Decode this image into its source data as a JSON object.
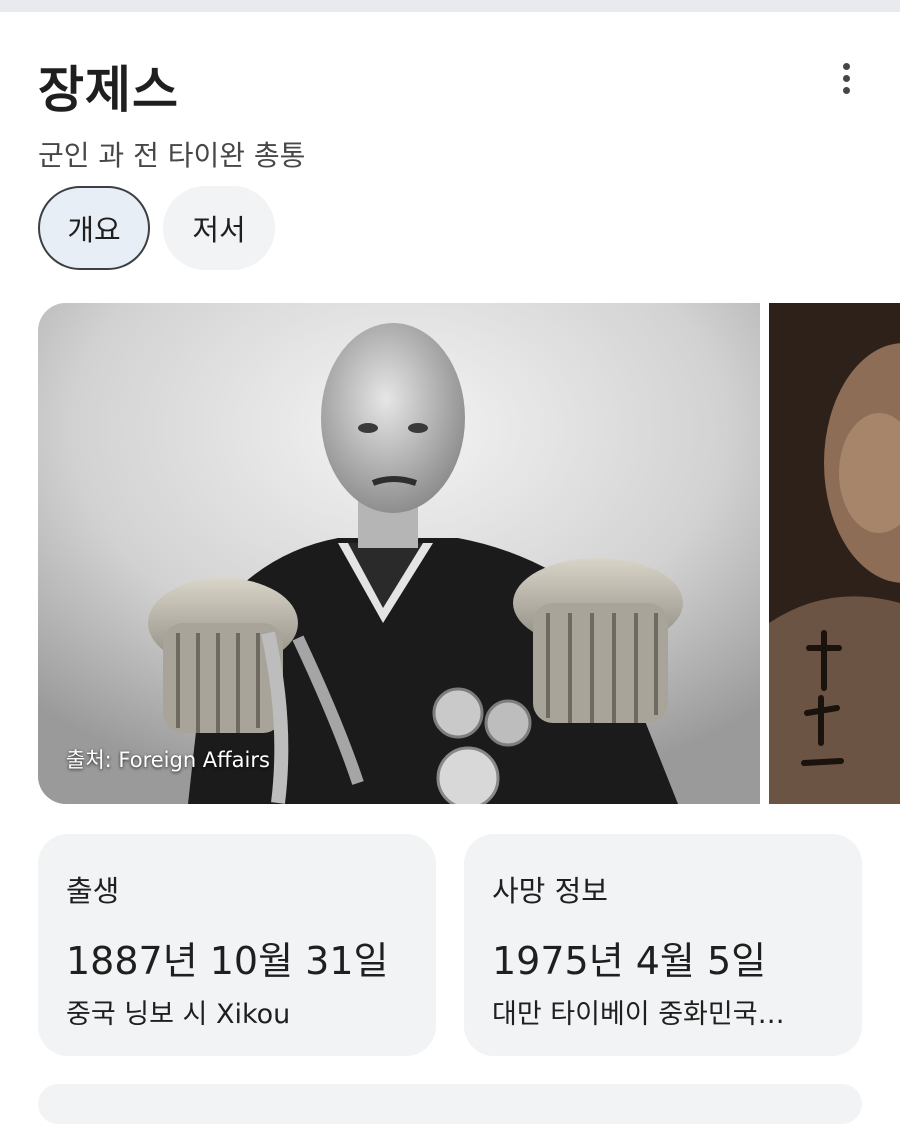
{
  "entity": {
    "title": "장제스",
    "subtitle": "군인 과 전 타이완 총통"
  },
  "tabs": [
    {
      "label": "개요",
      "active": true
    },
    {
      "label": "저서",
      "active": false
    }
  ],
  "images": {
    "main_credit": "출처: Foreign Affairs",
    "main_alt": "Portrait of Chiang Kai-shek in military uniform",
    "side_alt": "Portrait with calligraphy signature"
  },
  "facts": {
    "birth": {
      "label": "출생",
      "date": "1887년 10월 31일",
      "place": "중국 닝보 시 Xikou"
    },
    "death": {
      "label": "사망 정보",
      "date": "1975년 4월 5일",
      "place": "대만 타이베이 중화민국…"
    }
  },
  "icons": {
    "more": "more-vert-icon"
  },
  "colors": {
    "chip_active_bg": "#e8eef5",
    "card_bg": "#f1f3f4",
    "text": "#1f1f1f"
  }
}
